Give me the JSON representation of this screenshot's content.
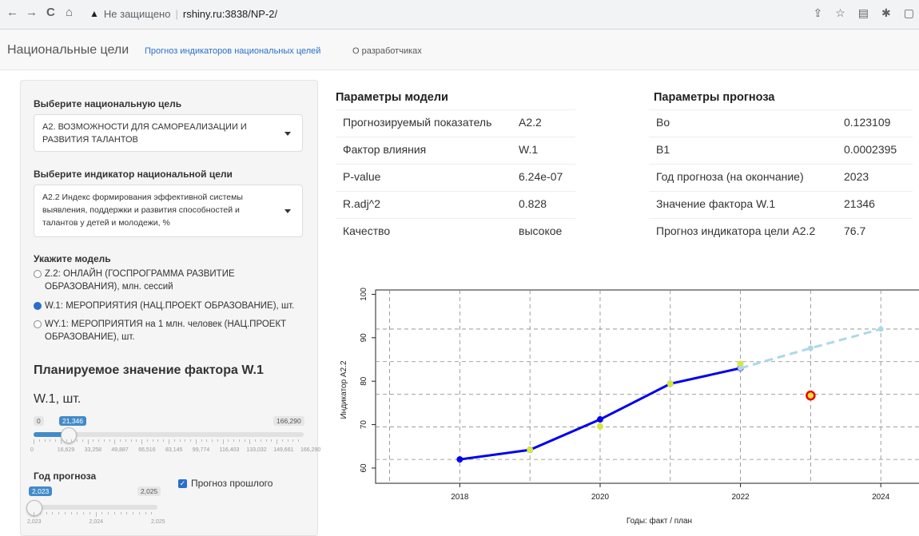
{
  "browser": {
    "nav": {
      "back": "←",
      "forward": "→",
      "reload": "C",
      "home": "⌂"
    },
    "security": "Не защищено",
    "url": "rshiny.ru:3838/NP-2/"
  },
  "navbar": {
    "brand": "Национальные цели",
    "links": [
      "Прогноз индикаторов национальных целей",
      "О разработчиках"
    ],
    "link_color": "#2a6fc9"
  },
  "sidebar": {
    "goal_label": "Выберите национальную цель",
    "goal_value": "А2. ВОЗМОЖНОСТИ ДЛЯ САМОРЕАЛИЗАЦИИ И РАЗВИТИЯ ТАЛАНТОВ",
    "indicator_label": "Выберите индикатор национальной цели",
    "indicator_value": "А2.2 Индекс формирования эффективной системы выявления, поддержки и развития способностей и талантов у детей и молодежи, %",
    "model_label": "Укажите модель",
    "models": [
      {
        "text": "Z.2: ОНЛАЙН (ГОСПРОГРАММА РАЗВИТИЕ ОБРАЗОВАНИЯ), млн. сессий",
        "selected": false
      },
      {
        "text": "W.1: МЕРОПРИЯТИЯ (НАЦ.ПРОЕКТ ОБРАЗОВАНИЕ), шт.",
        "selected": true
      },
      {
        "text": "WY.1: МЕРОПРИЯТИЯ на 1 млн. человек (НАЦ.ПРОЕКТ ОБРАЗОВАНИЕ), шт.",
        "selected": false
      }
    ],
    "plan_title": "Планируемое значение фактора W.1",
    "factor_label": "W.1, шт.",
    "factor_slider": {
      "min": "0",
      "max": "166,290",
      "value": "21,346",
      "value_num": 21346,
      "max_num": 166290,
      "ticks": [
        "0",
        "16,629",
        "33,258",
        "49,887",
        "66,516",
        "83,145",
        "99,774",
        "116,403",
        "133,032",
        "149,661",
        "166,290"
      ]
    },
    "year_label": "Год прогноза",
    "year_slider": {
      "value": "2,023",
      "max": "2,025",
      "min_num": 2023,
      "max_num": 2025,
      "value_num": 2023,
      "ticks": [
        "2,023",
        "2,024",
        "2,025"
      ]
    },
    "past_forecast_label": "Прогноз прошлого",
    "past_forecast_checked": true
  },
  "model_params": {
    "title": "Параметры модели",
    "rows": [
      [
        "Прогнозируемый показатель",
        "A2.2"
      ],
      [
        "Фактор влияния",
        "W.1"
      ],
      [
        "P-value",
        "6.24e-07"
      ],
      [
        "R.adj^2",
        "0.828"
      ],
      [
        "Качество",
        "высокое"
      ]
    ]
  },
  "forecast_params": {
    "title": "Параметры прогноза",
    "rows": [
      [
        "Bo",
        "0.123109"
      ],
      [
        "B1",
        "0.0002395"
      ],
      [
        "Год прогноза (на окончание)",
        "2023"
      ],
      [
        "Значение фактора W.1",
        "21346"
      ],
      [
        "Прогноз индикатора цели A2.2",
        "76.7"
      ]
    ]
  },
  "chart_data": {
    "type": "line",
    "xlabel": "Годы: факт / план",
    "ylabel": "Индикатор А2.2",
    "xlim": [
      2016.8,
      2025.0
    ],
    "ylim": [
      56.5,
      101
    ],
    "xticks": [
      "2018",
      "2020",
      "2022",
      "2024"
    ],
    "yticks": [
      "60",
      "70",
      "80",
      "90",
      "100"
    ],
    "hgrid": [
      62,
      69.5,
      77,
      84.5,
      92
    ],
    "vgrid": [
      2017,
      2018,
      2019,
      2020,
      2021,
      2022,
      2023,
      2024
    ],
    "grid": true,
    "series": [
      {
        "style": "fact",
        "color": "#0000ee",
        "x": [
          2018,
          2019,
          2020,
          2021,
          2022
        ],
        "y": [
          62,
          64.2,
          71.2,
          79.4,
          83
        ]
      },
      {
        "style": "fit",
        "color": "#d4e83a",
        "x": [
          2019,
          2020,
          2021,
          2022
        ],
        "y": [
          64.2,
          69.6,
          79.4,
          84
        ]
      },
      {
        "style": "plan",
        "color": "#add8e6",
        "x": [
          2022,
          2023,
          2024
        ],
        "y": [
          83,
          87.6,
          92
        ]
      },
      {
        "style": "forecast",
        "color": "#ee0000",
        "x": [
          2023
        ],
        "y": [
          76.7
        ]
      }
    ]
  }
}
